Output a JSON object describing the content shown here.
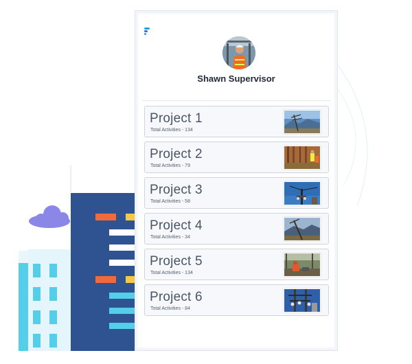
{
  "profile": {
    "name": "Shawn Supervisor",
    "avatar_icon": "avatar-photo"
  },
  "projects": [
    {
      "title": "Project 1",
      "meta": "Total Activities - 134",
      "thumbnail": "power-line-mountain-photo"
    },
    {
      "title": "Project 2",
      "meta": "Total Activities - 79",
      "thumbnail": "forest-workers-photo"
    },
    {
      "title": "Project 3",
      "meta": "Total Activities - 58",
      "thumbnail": "utility-pole-sky-photo"
    },
    {
      "title": "Project 4",
      "meta": "Total Activities - 34",
      "thumbnail": "leaning-pole-hills-photo"
    },
    {
      "title": "Project 5",
      "meta": "Total Activities - 134",
      "thumbnail": "field-worker-photo"
    },
    {
      "title": "Project 6",
      "meta": "Total Activities - 84",
      "thumbnail": "pole-equipment-photo"
    }
  ],
  "colors": {
    "title_text": "#4a5566",
    "card_border": "#cfd5de",
    "building_dark": "#2f5391",
    "building_light": "#55cfe9",
    "accent_orange": "#f26a3a",
    "accent_yellow": "#f6c945",
    "cloud": "#8b87e6"
  }
}
